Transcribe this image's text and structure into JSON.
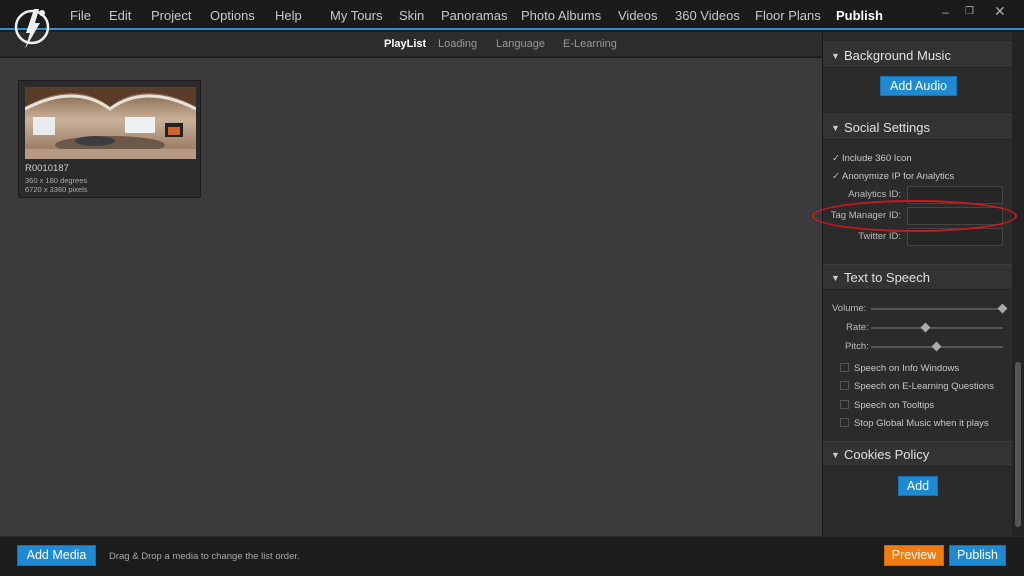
{
  "menubar": {
    "items": [
      "File",
      "Edit",
      "Project",
      "Options",
      "Help",
      "My Tours",
      "Skin",
      "Panoramas",
      "Photo Albums",
      "Videos",
      "360 Videos",
      "Floor Plans",
      "Publish"
    ],
    "active": "Publish",
    "window_controls": [
      "minimize-icon",
      "restore-icon",
      "close-icon"
    ]
  },
  "subtabs": {
    "items": [
      "PlayList",
      "Loading",
      "Language",
      "E-Learning"
    ],
    "active": "PlayList"
  },
  "media": {
    "name": "R0010187",
    "degrees": "360 x 180 degrees",
    "pixels": "6720 x 3360 pixels"
  },
  "panel": {
    "background_music": {
      "title": "Background Music",
      "button": "Add Audio"
    },
    "social_settings": {
      "title": "Social Settings",
      "include_360_icon": "Include 360 Icon",
      "anonymize_ip": "Anonymize IP for Analytics",
      "analytics_label": "Analytics ID:",
      "tag_manager_label": "Tag Manager ID:",
      "twitter_label": "Twitter ID:"
    },
    "text_to_speech": {
      "title": "Text to Speech",
      "volume_label": "Volume:",
      "rate_label": "Rate:",
      "pitch_label": "Pitch:",
      "volume": 1.0,
      "rate": 0.42,
      "pitch": 0.5,
      "options": [
        "Speech on Info Windows",
        "Speech on E-Learning Questions",
        "Speech on Tooltips",
        "Stop Global Music when it plays"
      ]
    },
    "cookies_policy": {
      "title": "Cookies Policy",
      "button": "Add"
    }
  },
  "bottom": {
    "add_media": "Add Media",
    "hint": "Drag & Drop a media to change the list order.",
    "preview": "Preview",
    "publish": "Publish"
  },
  "colors": {
    "accent_blue": "#1f8ad2",
    "orange": "#f07b12",
    "highlight_red": "#c8191f"
  }
}
